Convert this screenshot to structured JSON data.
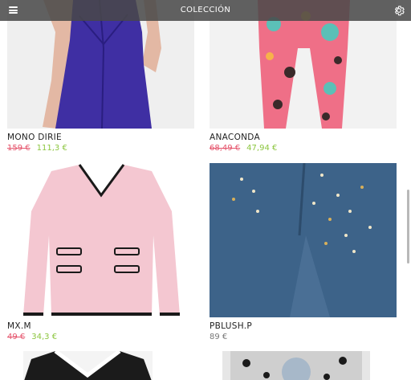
{
  "header": {
    "title": "COLECCIÓN",
    "menu_icon": "hamburger-menu-icon",
    "settings_icon": "gear-icon"
  },
  "products": [
    {
      "name": "MONO DIRIE",
      "old_price": "159 €",
      "new_price": "111,3 €"
    },
    {
      "name": "ANACONDA",
      "old_price": "68,49 €",
      "new_price": "47,94 €"
    },
    {
      "name": "MX.M",
      "old_price": "49 €",
      "new_price": "34,3 €"
    },
    {
      "name": "PBLUSH.P",
      "price": "89 €"
    }
  ],
  "colors": {
    "old_price": "#e5536b",
    "new_price": "#8cc63f",
    "regular_price": "#777777",
    "topbar": "#484848"
  }
}
